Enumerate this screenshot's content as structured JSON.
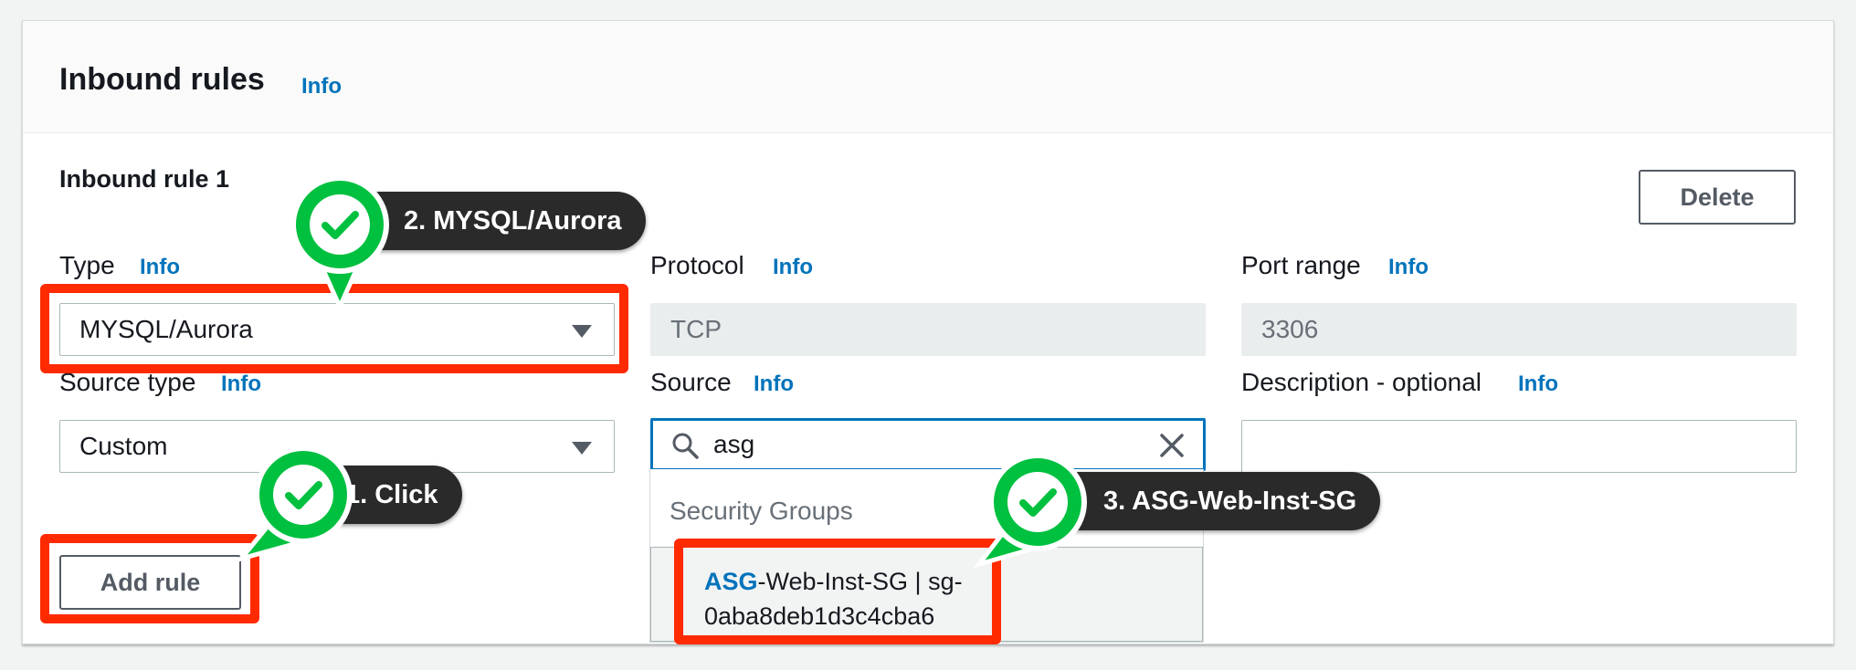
{
  "panel": {
    "title": "Inbound rules",
    "info": "Info"
  },
  "rule": {
    "title": "Inbound rule 1",
    "delete_label": "Delete",
    "type": {
      "label": "Type",
      "info": "Info",
      "value": "MYSQL/Aurora"
    },
    "protocol": {
      "label": "Protocol",
      "info": "Info",
      "value": "TCP"
    },
    "port_range": {
      "label": "Port range",
      "info": "Info",
      "value": "3306"
    },
    "source_type": {
      "label": "Source type",
      "info": "Info",
      "value": "Custom"
    },
    "source": {
      "label": "Source",
      "info": "Info",
      "value": "asg",
      "dropdown": {
        "group_label": "Security Groups",
        "option_highlight": "ASG",
        "option_rest": "-Web-Inst-SG | sg-0aba8deb1d3c4cba6"
      }
    },
    "description": {
      "label": "Description - optional",
      "info": "Info",
      "value": ""
    }
  },
  "add_rule_label": "Add rule",
  "annotations": {
    "step1": "1. Click",
    "step2": "2. MYSQL/Aurora",
    "step3": "3. ASG-Web-Inst-SG"
  },
  "colors": {
    "accent": "#0073bb",
    "highlight_box": "#ff2a00",
    "check_badge": "#00c040",
    "callout_bg": "#2a2a2a"
  },
  "icons": {
    "search": "search-icon",
    "clear": "close-icon",
    "dropdown": "caret-down-icon",
    "check": "check-icon"
  }
}
